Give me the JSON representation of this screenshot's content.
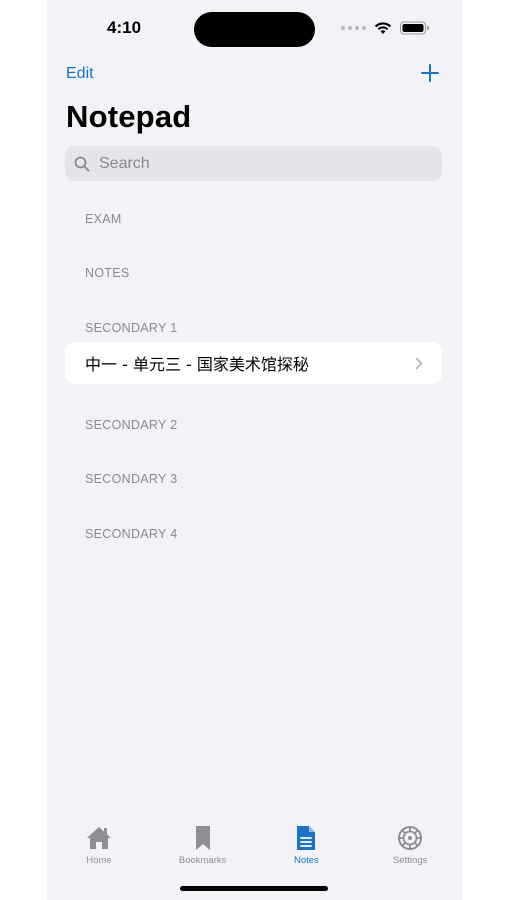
{
  "status_bar": {
    "time": "4:10"
  },
  "nav": {
    "edit_label": "Edit",
    "add_icon": "plus-icon"
  },
  "page_title": "Notepad",
  "search": {
    "placeholder": "Search",
    "value": ""
  },
  "sections": [
    {
      "header": "EXAM",
      "items": []
    },
    {
      "header": "NOTES",
      "items": []
    },
    {
      "header": "SECONDARY 1",
      "items": [
        {
          "label": "中一 - 单元三 - 国家美术馆探秘"
        }
      ]
    },
    {
      "header": "SECONDARY 2",
      "items": []
    },
    {
      "header": "SECONDARY 3",
      "items": []
    },
    {
      "header": "SECONDARY 4",
      "items": []
    }
  ],
  "tabbar": {
    "tabs": [
      {
        "label": "Home",
        "icon": "house-icon",
        "active": false
      },
      {
        "label": "Bookmarks",
        "icon": "bookmark-icon",
        "active": false
      },
      {
        "label": "Notes",
        "icon": "notes-icon",
        "active": true
      },
      {
        "label": "Settings",
        "icon": "gear-icon",
        "active": false
      }
    ]
  },
  "colors": {
    "accent": "#1a73c9",
    "background": "#f2f2f7",
    "secondary_text": "#8a8a8e"
  }
}
